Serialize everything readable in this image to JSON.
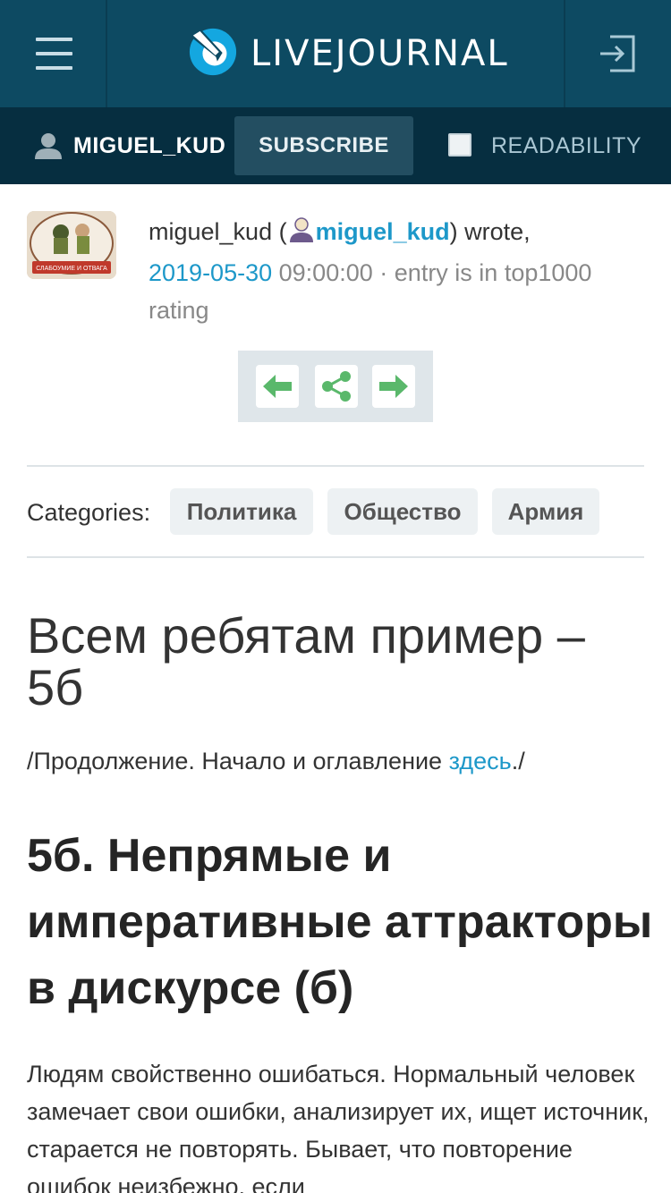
{
  "header": {
    "logo_text": "LIVEJOURNAL"
  },
  "subbar": {
    "username": "MIGUEL_KUD",
    "subscribe_label": "SUBSCRIBE",
    "readability_label": "READABILITY"
  },
  "entry": {
    "author": "miguel_kud",
    "author_link": "miguel_kud",
    "wrote": "wrote,",
    "date": "2019-05-30",
    "time": "09:00:00",
    "separator": "·",
    "rating_text": "entry is in top1000",
    "rating_text2": "rating",
    "avatar_caption": "СЛАБОУМИЕ И ОТВАГА"
  },
  "categories": {
    "label": "Categories:",
    "tags": [
      "Политика",
      "Общество",
      "Армия"
    ]
  },
  "post": {
    "title": "Всем ребятам пример – 5б",
    "intro_prefix": "/Продолжение. Начало и оглавление ",
    "intro_link": "здесь",
    "intro_suffix": "./",
    "heading": "5б. Непрямые и императивные аттракторы в дискурсе (б)",
    "paragraph": "Людям свойственно ошибаться. Нормальный человек замечает свои ошибки, анализирует их, ищет источник, старается не повторять. Бывает, что повторение ошибок неизбежно, если"
  },
  "colors": {
    "header_bg": "#0d4a62",
    "subbar_bg": "#062e40",
    "link": "#1d98c9",
    "nav_green": "#5ab86b"
  },
  "icons": [
    "hamburger-icon",
    "livejournal-logo-icon",
    "login-icon",
    "user-icon",
    "arrow-left-icon",
    "share-icon",
    "arrow-right-icon"
  ]
}
